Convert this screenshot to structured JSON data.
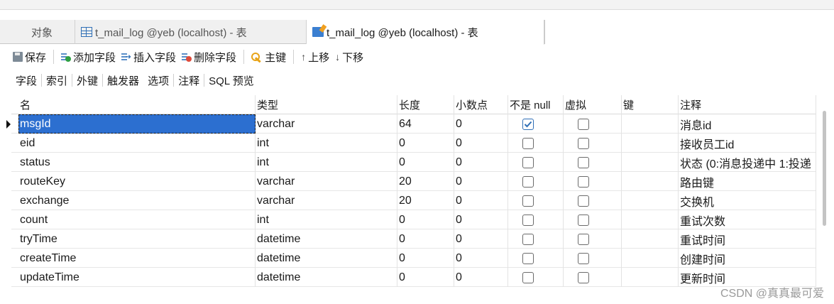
{
  "tabs": [
    {
      "label": "对象",
      "icon": "none",
      "active": false
    },
    {
      "label": "t_mail_log @yeb (localhost) - 表",
      "icon": "table-grid-icon",
      "active": false
    },
    {
      "label": "t_mail_log @yeb (localhost) - 表",
      "icon": "table-design-icon",
      "active": true
    }
  ],
  "toolbar": {
    "save": "保存",
    "add_field": "添加字段",
    "insert_field": "插入字段",
    "delete_field": "删除字段",
    "primary_key": "主键",
    "move_up": "上移",
    "move_down": "下移",
    "up_arrow": "↑",
    "down_arrow": "↓"
  },
  "subtabs": [
    "字段",
    "索引",
    "外键",
    "触发器",
    "选项",
    "注释",
    "SQL 预览"
  ],
  "columns": [
    "名",
    "类型",
    "长度",
    "小数点",
    "不是 null",
    "虚拟",
    "键",
    "注释"
  ],
  "rows": [
    {
      "name": "msgId",
      "type": "varchar",
      "length": "64",
      "decimals": "0",
      "not_null": true,
      "virtual": false,
      "key": "",
      "comment": "消息id"
    },
    {
      "name": "eid",
      "type": "int",
      "length": "0",
      "decimals": "0",
      "not_null": false,
      "virtual": false,
      "key": "",
      "comment": "接收员工id"
    },
    {
      "name": "status",
      "type": "int",
      "length": "0",
      "decimals": "0",
      "not_null": false,
      "virtual": false,
      "key": "",
      "comment": "状态 (0:消息投递中 1:投递"
    },
    {
      "name": "routeKey",
      "type": "varchar",
      "length": "20",
      "decimals": "0",
      "not_null": false,
      "virtual": false,
      "key": "",
      "comment": "路由键"
    },
    {
      "name": "exchange",
      "type": "varchar",
      "length": "20",
      "decimals": "0",
      "not_null": false,
      "virtual": false,
      "key": "",
      "comment": "交换机"
    },
    {
      "name": "count",
      "type": "int",
      "length": "0",
      "decimals": "0",
      "not_null": false,
      "virtual": false,
      "key": "",
      "comment": "重试次数"
    },
    {
      "name": "tryTime",
      "type": "datetime",
      "length": "0",
      "decimals": "0",
      "not_null": false,
      "virtual": false,
      "key": "",
      "comment": "重试时间"
    },
    {
      "name": "createTime",
      "type": "datetime",
      "length": "0",
      "decimals": "0",
      "not_null": false,
      "virtual": false,
      "key": "",
      "comment": "创建时间"
    },
    {
      "name": "updateTime",
      "type": "datetime",
      "length": "0",
      "decimals": "0",
      "not_null": false,
      "virtual": false,
      "key": "",
      "comment": "更新时间"
    }
  ],
  "selected_row": 0,
  "watermark": "CSDN @真真最可爱",
  "colors": {
    "selection": "#2c6fd0",
    "check": "#2f6fb6",
    "accent_key": "#e8a317"
  }
}
